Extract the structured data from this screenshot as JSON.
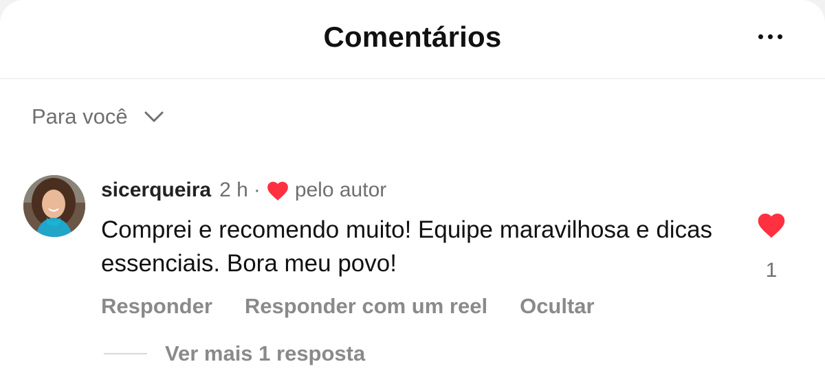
{
  "header": {
    "title": "Comentários",
    "more_icon": "more-horizontal-icon"
  },
  "filter": {
    "label": "Para você",
    "icon": "chevron-down-icon"
  },
  "comment": {
    "username": "sicerqueira",
    "time": "2 h",
    "separator": "·",
    "liked_by_author": "pelo autor",
    "text": "Comprei e recomendo muito! Equipe maravilhosa e dicas essenciais.  Bora meu povo!",
    "like_count": "1",
    "actions": {
      "reply": "Responder",
      "reply_reel": "Responder com um reel",
      "hide": "Ocultar"
    },
    "heart_color": "#ff3040"
  },
  "replies": {
    "label": "Ver mais 1 resposta"
  }
}
